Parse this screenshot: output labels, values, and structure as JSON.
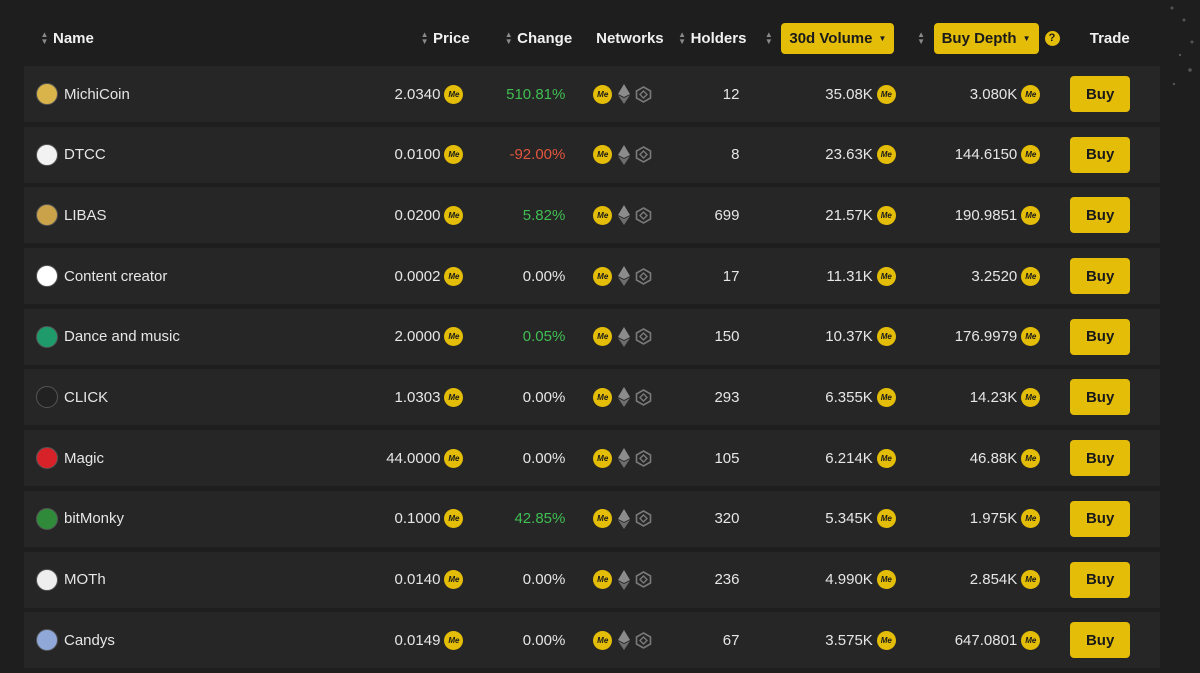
{
  "header": {
    "name": "Name",
    "price": "Price",
    "change": "Change",
    "networks": "Networks",
    "holders": "Holders",
    "volume": "30d Volume",
    "depth": "Buy Depth",
    "trade": "Trade",
    "help": "?"
  },
  "currency_symbol": "Me",
  "buy_label": "Buy",
  "colors": {
    "accent": "#e3bd08",
    "positive": "#3fbf52",
    "negative": "#e2553f"
  },
  "rows": [
    {
      "name": "MichiCoin",
      "price": "2.0340",
      "change": "510.81%",
      "dir": "pos",
      "holders": "12",
      "volume": "35.08K",
      "depth": "3.080K",
      "avatar_color": "#d9b44a"
    },
    {
      "name": "DTCC",
      "price": "0.0100",
      "change": "-92.00%",
      "dir": "neg",
      "holders": "8",
      "volume": "23.63K",
      "depth": "144.6150",
      "avatar_color": "#f2f2f2"
    },
    {
      "name": "LIBAS",
      "price": "0.0200",
      "change": "5.82%",
      "dir": "pos",
      "holders": "699",
      "volume": "21.57K",
      "depth": "190.9851",
      "avatar_color": "#c9a24a"
    },
    {
      "name": "Content creator",
      "price": "0.0002",
      "change": "0.00%",
      "dir": "neu",
      "holders": "17",
      "volume": "11.31K",
      "depth": "3.2520",
      "avatar_color": "#ffffff"
    },
    {
      "name": "Dance and music",
      "price": "2.0000",
      "change": "0.05%",
      "dir": "pos",
      "holders": "150",
      "volume": "10.37K",
      "depth": "176.9979",
      "avatar_color": "#1f9a6a"
    },
    {
      "name": "CLICK",
      "price": "1.0303",
      "change": "0.00%",
      "dir": "neu",
      "holders": "293",
      "volume": "6.355K",
      "depth": "14.23K",
      "avatar_color": "#222222"
    },
    {
      "name": "Magic",
      "price": "44.0000",
      "change": "0.00%",
      "dir": "neu",
      "holders": "105",
      "volume": "6.214K",
      "depth": "46.88K",
      "avatar_color": "#d8222a"
    },
    {
      "name": "bitMonky",
      "price": "0.1000",
      "change": "42.85%",
      "dir": "pos",
      "holders": "320",
      "volume": "5.345K",
      "depth": "1.975K",
      "avatar_color": "#2f8a3a"
    },
    {
      "name": "MOTh",
      "price": "0.0140",
      "change": "0.00%",
      "dir": "neu",
      "holders": "236",
      "volume": "4.990K",
      "depth": "2.854K",
      "avatar_color": "#eeeeee"
    },
    {
      "name": "Candys",
      "price": "0.0149",
      "change": "0.00%",
      "dir": "neu",
      "holders": "67",
      "volume": "3.575K",
      "depth": "647.0801",
      "avatar_color": "#8fa8d8"
    }
  ]
}
